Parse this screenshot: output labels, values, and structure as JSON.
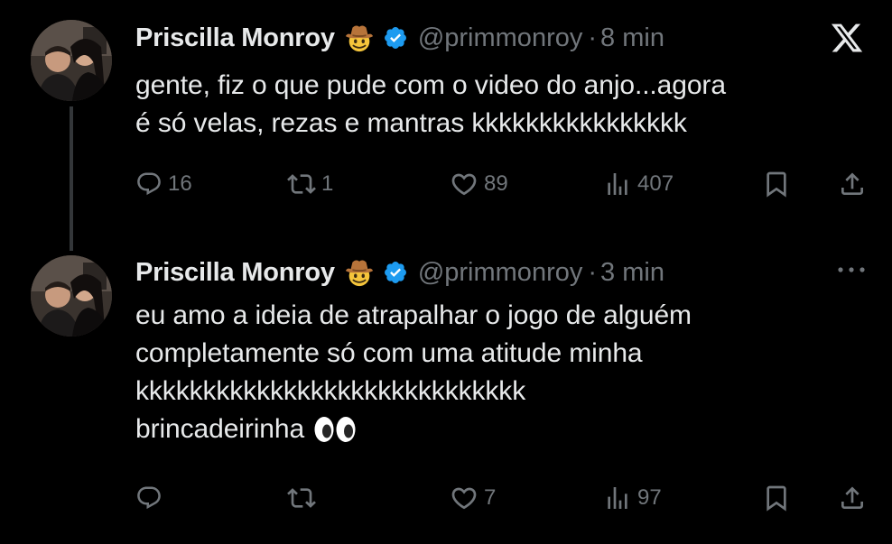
{
  "colors": {
    "background": "#000000",
    "text": "#e7e9ea",
    "secondary": "#71767b",
    "verified": "#1d9bf0",
    "thread_line": "#333639"
  },
  "tweets": [
    {
      "author_name": "Priscilla Monroy",
      "name_emoji": "cowboy-hat-face",
      "verified_icon": "verified-badge-icon",
      "handle": "@primmonroy",
      "separator": "·",
      "time": "8 min",
      "corner_icon": "x-logo-icon",
      "text_lines": [
        "gente, fiz o que pude com o video do anjo...agora",
        "é só velas, rezas e mantras kkkkkkkkkkkkkkkk"
      ],
      "stats": {
        "replies": "16",
        "reposts": "1",
        "likes": "89",
        "views": "407"
      }
    },
    {
      "author_name": "Priscilla Monroy",
      "name_emoji": "cowboy-hat-face",
      "verified_icon": "verified-badge-icon",
      "handle": "@primmonroy",
      "separator": "·",
      "time": "3 min",
      "corner_icon": "more-options-icon",
      "text_lines": [
        "eu amo a ideia de atrapalhar o jogo de alguém",
        "completamente só com uma atitude minha",
        "kkkkkkkkkkkkkkkkkkkkkkkkkkkkk",
        "brincadeirinha"
      ],
      "text_emoji": "eyes",
      "stats": {
        "replies": "",
        "reposts": "",
        "likes": "7",
        "views": "97"
      }
    }
  ]
}
